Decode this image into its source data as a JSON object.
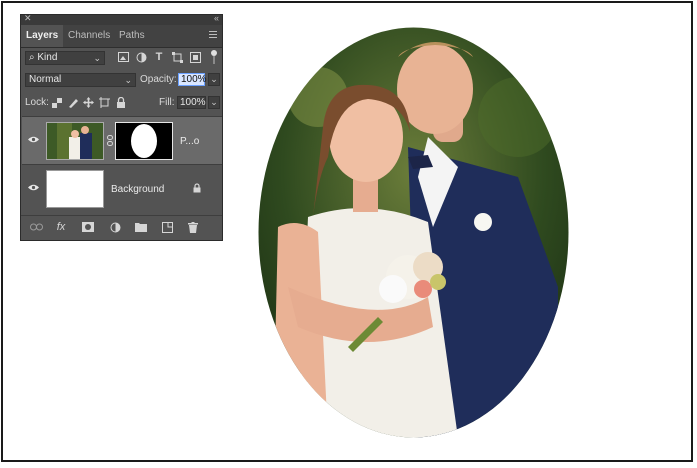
{
  "panel": {
    "tabs": [
      {
        "label": "Layers",
        "active": true
      },
      {
        "label": "Channels",
        "active": false
      },
      {
        "label": "Paths",
        "active": false
      }
    ],
    "filter": {
      "label": "Kind",
      "icon": "search-icon"
    },
    "filter_icons": [
      "image-filter-icon",
      "adjustment-filter-icon",
      "type-filter-icon",
      "shape-filter-icon",
      "smart-object-filter-icon"
    ],
    "blend_mode": "Normal",
    "opacity_label": "Opacity:",
    "opacity_value": "100%",
    "lock_label": "Lock:",
    "lock_icons": [
      "lock-transparent-pixels-icon",
      "lock-image-pixels-icon",
      "lock-position-icon",
      "lock-artboard-icon",
      "lock-all-icon"
    ],
    "fill_label": "Fill:",
    "fill_value": "100%",
    "layers": [
      {
        "name": "P...o",
        "selected": true,
        "has_mask": true,
        "visible": true
      },
      {
        "name": "Background",
        "selected": false,
        "locked": true,
        "visible": true
      }
    ],
    "bottom_icons": [
      "link-layers-icon",
      "fx-icon",
      "add-mask-icon",
      "adjustment-layer-icon",
      "new-group-icon",
      "new-layer-icon",
      "delete-layer-icon"
    ]
  },
  "colors": {
    "panel_bg": "#535353",
    "selected_layer": "#6a6a6a",
    "highlight": "#6aa0ff"
  }
}
